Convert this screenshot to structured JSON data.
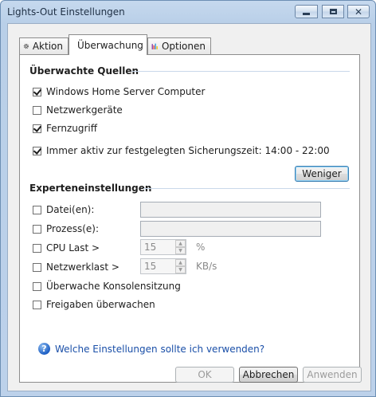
{
  "window": {
    "title": "Lights-Out Einstellungen"
  },
  "tabs": [
    {
      "label": "Aktion",
      "icon": "gear-icon"
    },
    {
      "label": "Überwachung",
      "icon": "gauge-icon"
    },
    {
      "label": "Optionen",
      "icon": "bar-chart-icon"
    }
  ],
  "monitored": {
    "title": "Überwachte Quellen",
    "items": [
      {
        "label": "Windows Home Server Computer",
        "checked": true
      },
      {
        "label": "Netzwerkgeräte",
        "checked": false
      },
      {
        "label": "Fernzugriff",
        "checked": true
      },
      {
        "label": "Immer aktiv zur festgelegten Sicherungszeit: 14:00 - 22:00",
        "checked": true
      }
    ],
    "less_button": "Weniger"
  },
  "expert": {
    "title": "Experteneinstellungen",
    "files_label": "Datei(en):",
    "files_value": "",
    "processes_label": "Prozess(e):",
    "processes_value": "",
    "cpu_label": "CPU Last >",
    "cpu_value": "15",
    "cpu_unit": "%",
    "net_label": "Netzwerklast >",
    "net_value": "15",
    "net_unit": "KB/s",
    "console_label": "Überwache Konsolensitzung",
    "shares_label": "Freigaben überwachen"
  },
  "help": {
    "link": "Welche Einstellungen sollte ich verwenden?"
  },
  "buttons": {
    "ok": "OK",
    "cancel": "Abbrechen",
    "apply": "Anwenden"
  }
}
